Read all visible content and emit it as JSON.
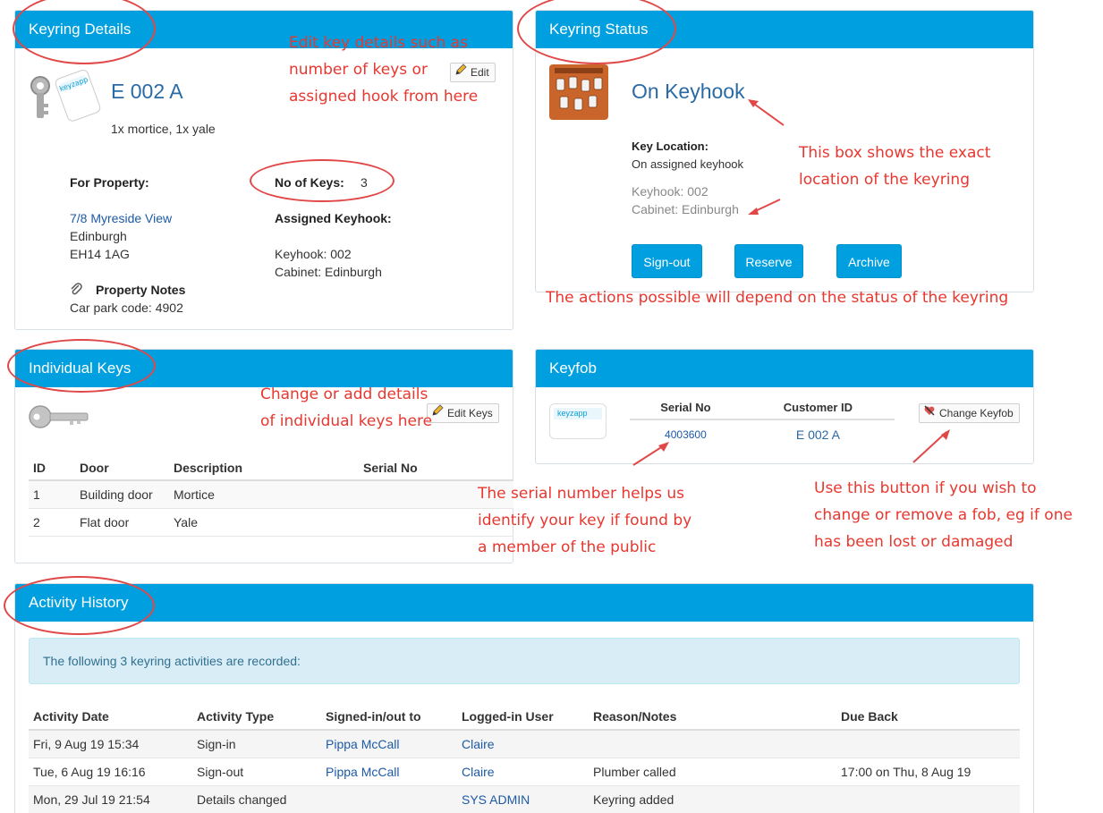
{
  "keyring_details": {
    "title": "Keyring Details",
    "edit_label": "Edit",
    "keyring_name": "E 002 A",
    "key_summary": "1x mortice, 1x yale",
    "for_property_label": "For Property:",
    "property_link": "7/8 Myreside View",
    "property_city": "Edinburgh",
    "property_postcode": "EH14 1AG",
    "no_of_keys_label": "No of Keys:",
    "no_of_keys_value": "3",
    "assigned_keyhook_label": "Assigned Keyhook:",
    "keyhook": "Keyhook: 002",
    "cabinet": "Cabinet: Edinburgh",
    "property_notes_label": "Property Notes",
    "property_notes": "Car park code: 4902",
    "keyzapp_tag_text": "keyzapp"
  },
  "keyring_status": {
    "title": "Keyring Status",
    "status": "On Keyhook",
    "key_location_label": "Key Location:",
    "key_location_value": "On assigned keyhook",
    "keyhook": "Keyhook: 002",
    "cabinet": "Cabinet: Edinburgh",
    "buttons": {
      "sign_out": "Sign-out",
      "reserve": "Reserve",
      "archive": "Archive"
    }
  },
  "individual_keys": {
    "title": "Individual Keys",
    "edit_label": "Edit Keys",
    "columns": [
      "ID",
      "Door",
      "Description",
      "Serial No"
    ],
    "rows": [
      {
        "id": "1",
        "door": "Building door",
        "description": "Mortice",
        "serial": ""
      },
      {
        "id": "2",
        "door": "Flat door",
        "description": "Yale",
        "serial": ""
      }
    ]
  },
  "keyfob": {
    "title": "Keyfob",
    "columns": [
      "Serial No",
      "Customer ID"
    ],
    "serial_no": "4003600",
    "customer_id": "E 002 A",
    "change_label": "Change Keyfob",
    "fob_brand": "keyzapp"
  },
  "activity_history": {
    "title": "Activity History",
    "info": "The following 3 keyring activities are recorded:",
    "columns": [
      "Activity Date",
      "Activity Type",
      "Signed-in/out to",
      "Logged-in User",
      "Reason/Notes",
      "Due Back"
    ],
    "rows": [
      {
        "date": "Fri, 9 Aug 19 15:34",
        "type": "Sign-in",
        "person": "Pippa McCall",
        "user": "Claire",
        "reason": "",
        "due": ""
      },
      {
        "date": "Tue, 6 Aug 19 16:16",
        "type": "Sign-out",
        "person": "Pippa McCall",
        "user": "Claire",
        "reason": "Plumber called",
        "due": "17:00 on Thu, 8 Aug 19"
      },
      {
        "date": "Mon, 29 Jul 19 21:54",
        "type": "Details changed",
        "person": "",
        "user": "SYS ADMIN",
        "reason": "Keyring added",
        "due": ""
      }
    ]
  },
  "annotations": {
    "edit_key_details": [
      "Edit key details such as",
      "number of keys or",
      "assigned hook from here"
    ],
    "exact_location": [
      "This box shows the exact",
      "location of the keyring"
    ],
    "actions_possible": "The actions possible will depend on the status of the keyring",
    "change_individual": [
      "Change or add details",
      "of individual keys here"
    ],
    "serial_number": [
      "The serial number helps us",
      "identify your key if found by",
      "a member of the public"
    ],
    "change_fob": [
      "Use this button if you wish to",
      "change or remove a fob, eg if one",
      "has been lost or damaged"
    ]
  },
  "colors": {
    "header": "#00a0e0",
    "link": "#1c5aa6",
    "annotation": "#e8372f",
    "info_bg": "#d9edf7"
  }
}
